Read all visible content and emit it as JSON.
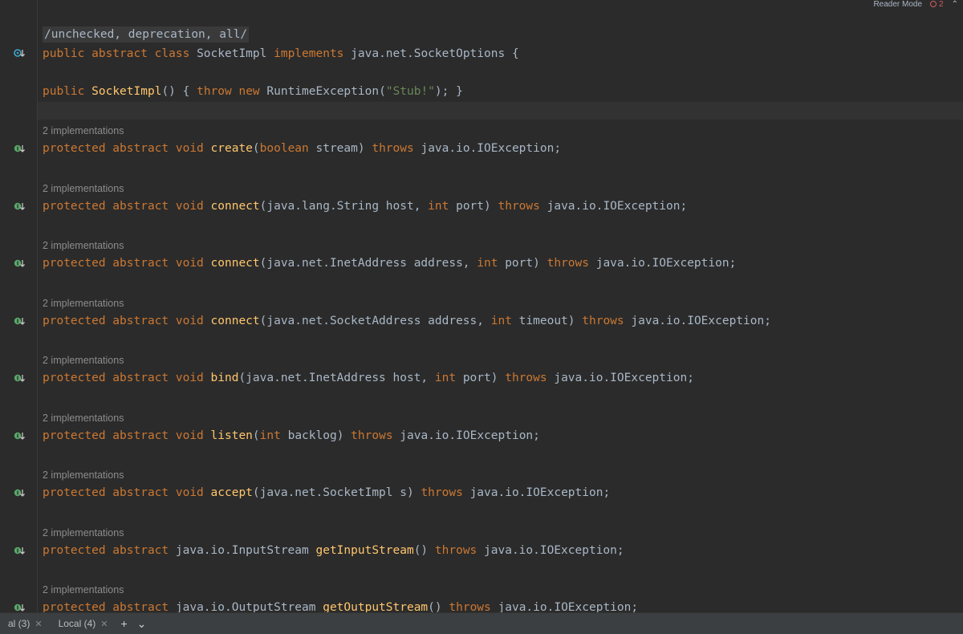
{
  "topbar": {
    "reader_mode": "Reader Mode",
    "error_count": "2"
  },
  "editor": {
    "suppress_text": "/unchecked, deprecation, all/",
    "class_decl": {
      "kw1": "public abstract class",
      "name": "SocketImpl",
      "kw2": "implements",
      "iface": "java.net.SocketOptions {"
    },
    "ctor": {
      "kw1": "public",
      "name": "SocketImpl",
      "mid": "() { ",
      "kw2": "throw new",
      "exc": "RuntimeException(",
      "str": "\"Stub!\"",
      "end": "); }"
    },
    "hint": "2 implementations",
    "methods": [
      {
        "mods": "protected abstract void",
        "name": "create",
        "open": "(",
        "p1kw": "boolean",
        "p1": " stream)",
        "p2kw": "",
        "p2": "",
        "throws": "throws",
        "exc": "java.io.IOException;"
      },
      {
        "mods": "protected abstract void",
        "name": "connect",
        "open": "(java.lang.String host, ",
        "p1kw": "int",
        "p1": " port)",
        "p2kw": "",
        "p2": "",
        "throws": "throws",
        "exc": "java.io.IOException;"
      },
      {
        "mods": "protected abstract void",
        "name": "connect",
        "open": "(java.net.InetAddress address, ",
        "p1kw": "int",
        "p1": " port)",
        "p2kw": "",
        "p2": "",
        "throws": "throws",
        "exc": "java.io.IOException;"
      },
      {
        "mods": "protected abstract void",
        "name": "connect",
        "open": "(java.net.SocketAddress address, ",
        "p1kw": "int",
        "p1": " timeout)",
        "p2kw": "",
        "p2": "",
        "throws": "throws",
        "exc": "java.io.IOException;"
      },
      {
        "mods": "protected abstract void",
        "name": "bind",
        "open": "(java.net.InetAddress host, ",
        "p1kw": "int",
        "p1": " port)",
        "p2kw": "",
        "p2": "",
        "throws": "throws",
        "exc": "java.io.IOException;"
      },
      {
        "mods": "protected abstract void",
        "name": "listen",
        "open": "(",
        "p1kw": "int",
        "p1": " backlog)",
        "p2kw": "",
        "p2": "",
        "throws": "throws",
        "exc": "java.io.IOException;"
      },
      {
        "mods": "protected abstract void",
        "name": "accept",
        "open": "(java.net.SocketImpl s)",
        "p1kw": "",
        "p1": "",
        "p2kw": "",
        "p2": "",
        "throws": "throws",
        "exc": "java.io.IOException;"
      },
      {
        "mods": "protected abstract",
        "type": "java.io.InputStream",
        "name": "getInputStream",
        "open": "()",
        "p1kw": "",
        "p1": "",
        "throws": "throws",
        "exc": "java.io.IOException;"
      },
      {
        "mods": "protected abstract",
        "type": "java.io.OutputStream",
        "name": "getOutputStream",
        "open": "()",
        "p1kw": "",
        "p1": "",
        "throws": "throws",
        "exc": "java.io.IOException;"
      }
    ]
  },
  "statusbar": {
    "tab1": "al (3)",
    "tab2": "Local (4)",
    "add": "+",
    "menu": "⌄"
  },
  "colors": {
    "keyword": "#cc7832",
    "function": "#ffc66d",
    "string": "#6a8759",
    "text": "#a9b7c6",
    "gutter_icon": "#59a869",
    "class_icon": "#40a9d0"
  },
  "icons": {
    "class_gutter": "implemented-class-icon",
    "method_gutter": "implemented-method-icon"
  }
}
